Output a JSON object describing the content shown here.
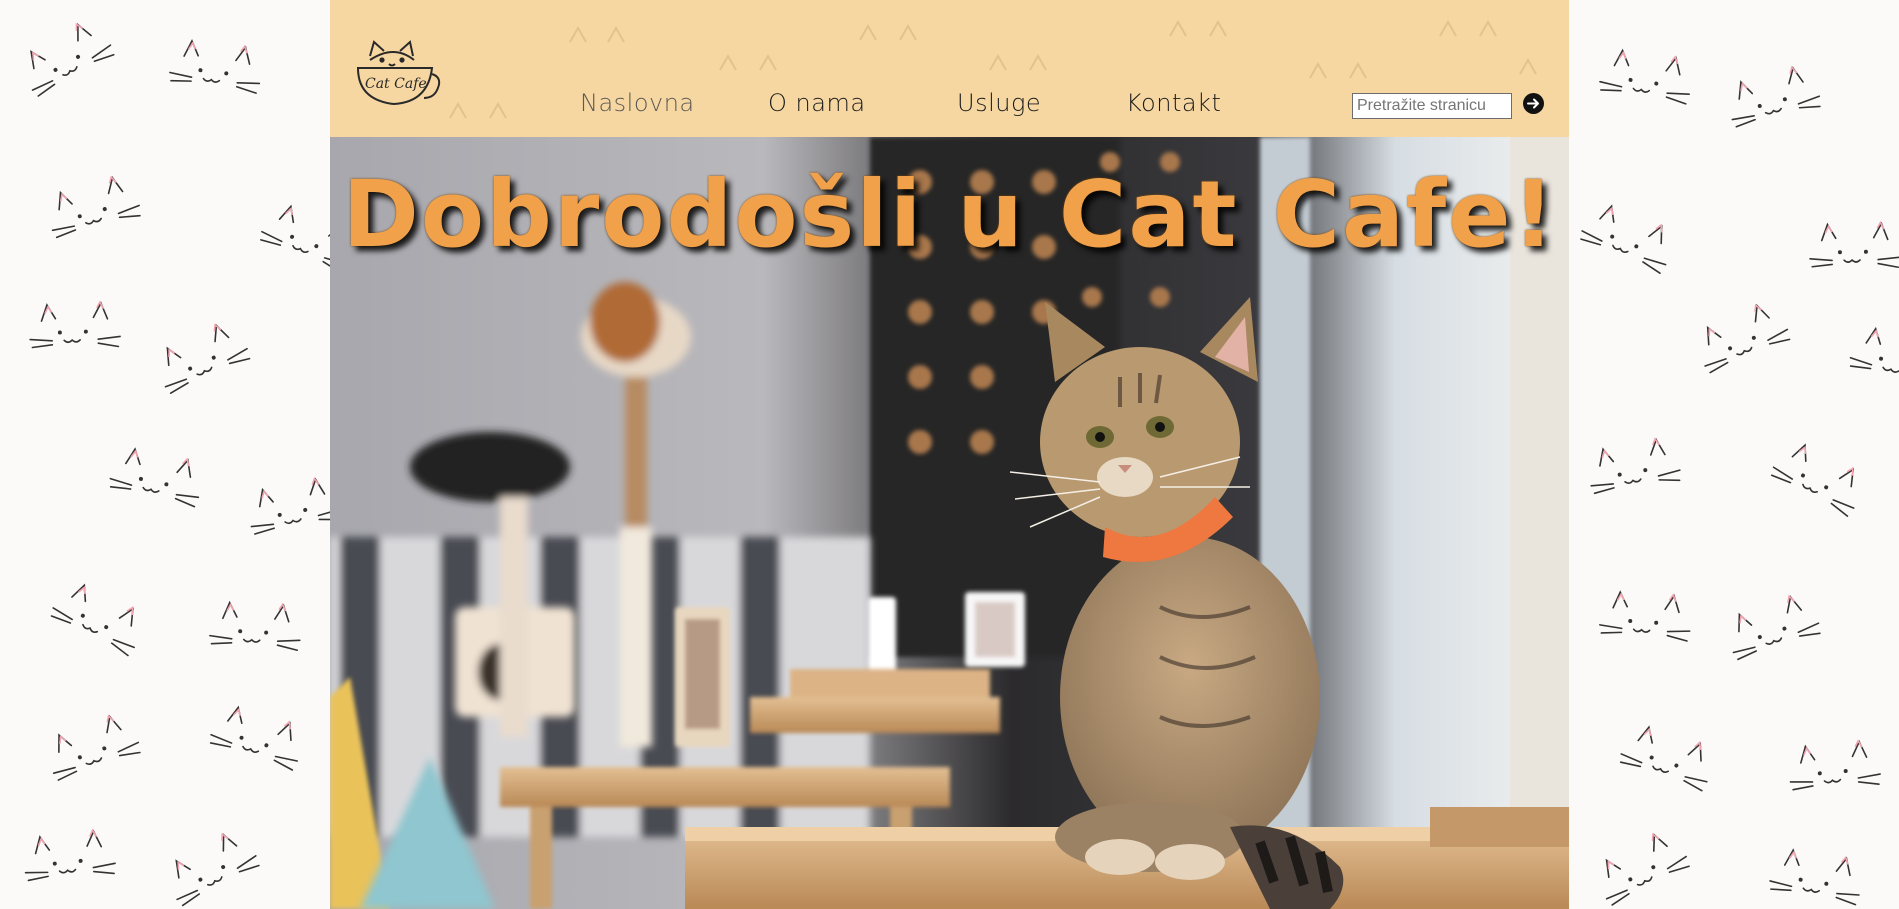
{
  "logo": {
    "text": "Cat Cafe",
    "icon": "cat-in-cup-logo"
  },
  "nav": {
    "items": [
      {
        "label": "Naslovna",
        "active": true
      },
      {
        "label": "O nama",
        "active": false
      },
      {
        "label": "Usluge",
        "active": false
      },
      {
        "label": "Kontakt",
        "active": false
      }
    ]
  },
  "search": {
    "placeholder": "Pretražite stranicu",
    "value": "",
    "button_icon": "arrow-right-icon"
  },
  "hero": {
    "title": "Dobrodošli u Cat Cafe!",
    "image": "cat sitting on wooden table in cafe interior"
  },
  "colors": {
    "header_bg": "#f6d7a2",
    "title": "#f0a14a",
    "page_bg": "#fbfaf9"
  }
}
